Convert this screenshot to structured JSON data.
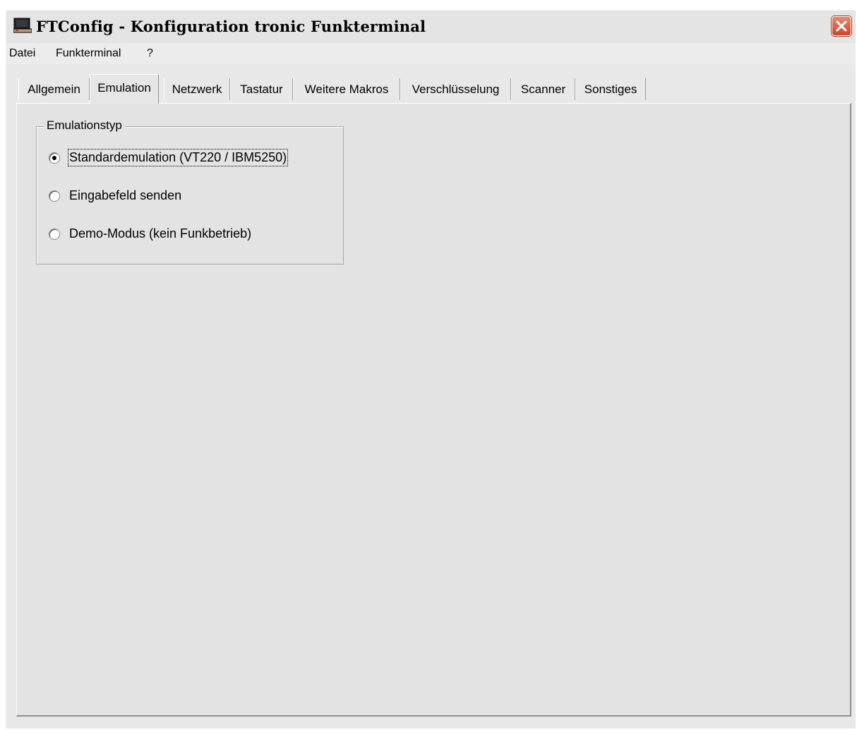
{
  "window": {
    "title": "FTConfig - Konfiguration tronic Funkterminal"
  },
  "menu": [
    {
      "label": "Datei"
    },
    {
      "label": "Funkterminal"
    },
    {
      "label": "?"
    }
  ],
  "tabs": [
    {
      "label": "Allgemein"
    },
    {
      "label": "Emulation",
      "active": true
    },
    {
      "label": "Netzwerk"
    },
    {
      "label": "Tastatur"
    },
    {
      "label": "Weitere Makros"
    },
    {
      "label": "Verschlüsselung"
    },
    {
      "label": "Scanner"
    },
    {
      "label": "Sonstiges"
    }
  ],
  "emulation": {
    "group_title": "Emulationstyp",
    "options": [
      {
        "label": "Standardemulation (VT220 / IBM5250)",
        "selected": true
      },
      {
        "label": "Eingabefeld senden",
        "selected": false
      },
      {
        "label": "Demo-Modus (kein Funkbetrieb)",
        "selected": false
      }
    ]
  },
  "icons": {
    "app": "terminal-icon",
    "close": "close-icon"
  },
  "colors": {
    "close_button": "#c9472b",
    "window_bg": "#e3e3e3"
  }
}
